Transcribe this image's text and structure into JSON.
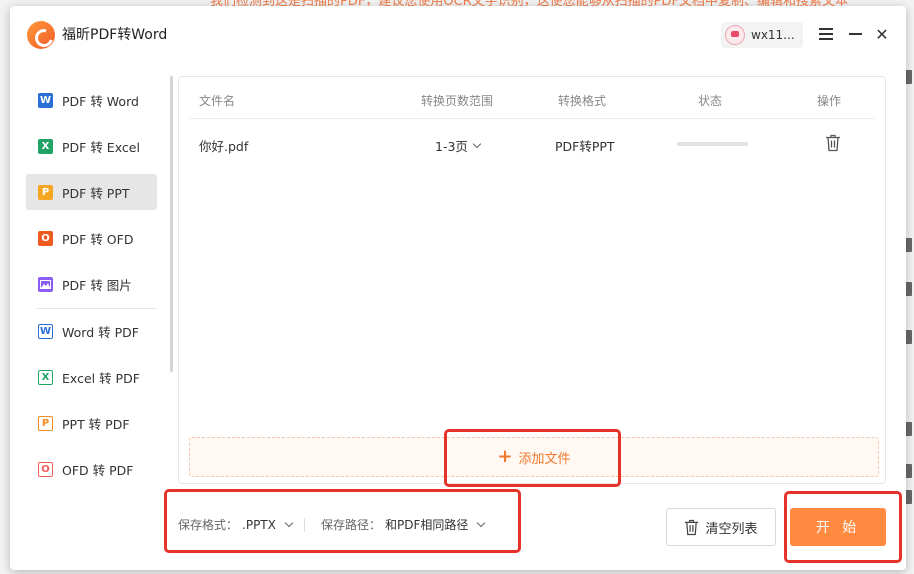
{
  "background": {
    "banner_text": "我们检测到这是扫描的PDF，建议您使用OCR文字识别，这使您能够从扫描的PDF文档中复制、编辑和搜索文本"
  },
  "titlebar": {
    "app_title": "福昕PDF转Word",
    "username": "wx11...",
    "icons": [
      "menu-icon",
      "minimize-icon",
      "close-icon"
    ]
  },
  "sidebar": {
    "items": [
      {
        "label": "PDF 转 Word",
        "icon": "W",
        "color": "#2b6fd6",
        "active": false
      },
      {
        "label": "PDF 转 Excel",
        "icon": "X",
        "color": "#21a366",
        "active": false
      },
      {
        "label": "PDF 转 PPT",
        "icon": "P",
        "color": "#f5a623",
        "active": true
      },
      {
        "label": "PDF 转 OFD",
        "icon": "O",
        "color": "#ef5b1f",
        "active": false
      },
      {
        "label": "PDF 转 图片",
        "icon": "img",
        "color": "#8b5cf6",
        "active": false
      },
      {
        "label": "Word 转 PDF",
        "icon": "W",
        "color": "#2b6fd6",
        "active": false
      },
      {
        "label": "Excel 转 PDF",
        "icon": "X",
        "color": "#21a366",
        "active": false
      },
      {
        "label": "PPT 转 PDF",
        "icon": "P",
        "color": "#f28a1e",
        "active": false
      },
      {
        "label": "OFD 转 PDF",
        "icon": "O",
        "color": "#ef5b5b",
        "active": false
      }
    ]
  },
  "table": {
    "headers": {
      "filename": "文件名",
      "range": "转换页数范围",
      "format": "转换格式",
      "status": "状态",
      "action": "操作"
    },
    "rows": [
      {
        "filename": "你好.pdf",
        "range": "1-3页",
        "format": "PDF转PPT",
        "progress": 0
      }
    ]
  },
  "add_file": {
    "label": "添加文件"
  },
  "bottom": {
    "format_label": "保存格式：",
    "format_value": ".PPTX",
    "path_label": "保存路径：",
    "path_value": "和PDF相同路径",
    "clear_label": "清空列表",
    "start_label": "开 始"
  },
  "colors": {
    "accent": "#ff8a40",
    "annotation": "#e5332a"
  }
}
